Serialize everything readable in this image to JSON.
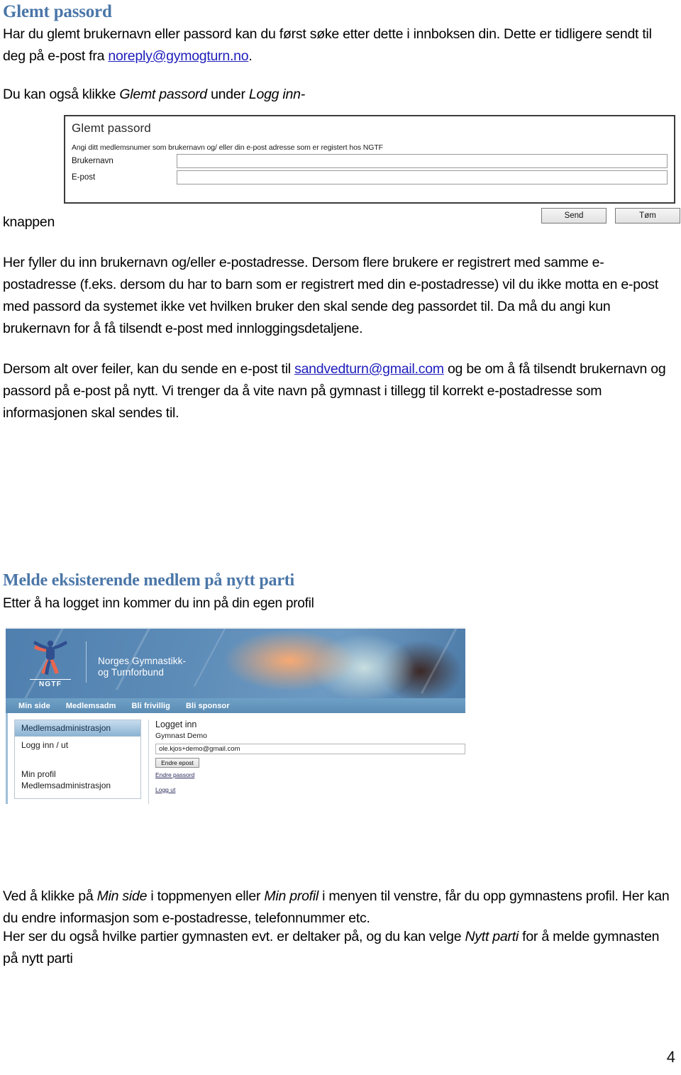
{
  "page": {
    "number": "4"
  },
  "section_forgot": {
    "heading": "Glemt passord",
    "intro_a": "Har du glemt brukernavn eller passord kan du først søke etter dette i innboksen din. Dette er tidligere sendt til deg på e-post fra ",
    "intro_link": "noreply@gymogturn.no",
    "intro_b": ".",
    "also_a": "Du kan også klikke ",
    "also_italic1": "Glemt passord",
    "also_b": " under ",
    "also_italic2": "Logg inn-",
    "knappen": "knappen",
    "fill_text": "Her fyller du inn brukernavn og/eller e-postadresse. Dersom flere brukere er registrert med samme e-postadresse (f.eks. dersom du har to barn som er registrert med din e-postadresse) vil du ikke motta en e-post med passord da systemet ikke vet hvilken bruker den skal sende deg passordet til. Da må du angi kun brukernavn for å få tilsendt e-post med innloggingsdetaljene.",
    "mail_a": "Dersom alt over feiler, kan du sende en e-post til ",
    "mail_link": "sandvedturn@gmail.com",
    "mail_b": " og be om å få tilsendt brukernavn og passord på e-post på nytt. Vi trenger da å vite navn på gymnast i tillegg til korrekt e-postadresse som informasjonen skal sendes til."
  },
  "forgot_form": {
    "title": "Glemt passord",
    "subtitle": "Angi ditt medlemsnumer som brukernavn og/ eller din e-post adresse som er registert hos NGTF",
    "fields": [
      {
        "label": "Brukernavn",
        "value": ""
      },
      {
        "label": "E-post",
        "value": ""
      }
    ],
    "buttons": {
      "send": "Send",
      "clear": "Tøm"
    }
  },
  "section_new_party": {
    "heading": "Melde eksisterende medlem på nytt parti",
    "profile_line": "Etter å ha logget inn kommer du inn på din egen profil",
    "bottom_1a": "Ved å klikke på ",
    "bottom_1_italic1": "Min side",
    "bottom_1b": " i toppmenyen eller ",
    "bottom_1_italic2": "Min profil",
    "bottom_1c": " i menyen til venstre, får du opp gymnastens profil. Her kan du endre informasjon som e-postadresse, telefonnummer etc.",
    "bottom_2a": "Her ser du også hvilke partier gymnasten evt. er deltaker på, og du kan velge ",
    "bottom_2_italic": "Nytt parti",
    "bottom_2b": " for å melde gymnasten på nytt parti"
  },
  "site_screenshot": {
    "logo_wordmark": "NGTF",
    "org_name_line1": "Norges Gymnastikk-",
    "org_name_line2": "og Turnforbund",
    "nav": [
      "Min side",
      "Medlemsadm",
      "Bli frivillig",
      "Bli sponsor"
    ],
    "sidebar": {
      "header": "Medlemsadministrasjon",
      "item_login": "Logg inn / ut",
      "item_profile": "Min profil",
      "item_admin": "Medlemsadministrasjon"
    },
    "main": {
      "logged_in_label": "Logget inn",
      "user_name": "Gymnast Demo",
      "email": "ole.kjos+demo@gmail.com",
      "change_email_button": "Endre epost",
      "change_password_link": "Endre passord",
      "logout_link": "Logg ut"
    },
    "colors": {
      "banner_blue": "#5d8cb8",
      "nav_blue": "#6fa0c6",
      "sidebar_header": "#8cb4d4"
    }
  },
  "theme": {
    "heading_blue": "#4a76a8",
    "link_blue": "#1d1dbb",
    "body_black": "#000000"
  }
}
